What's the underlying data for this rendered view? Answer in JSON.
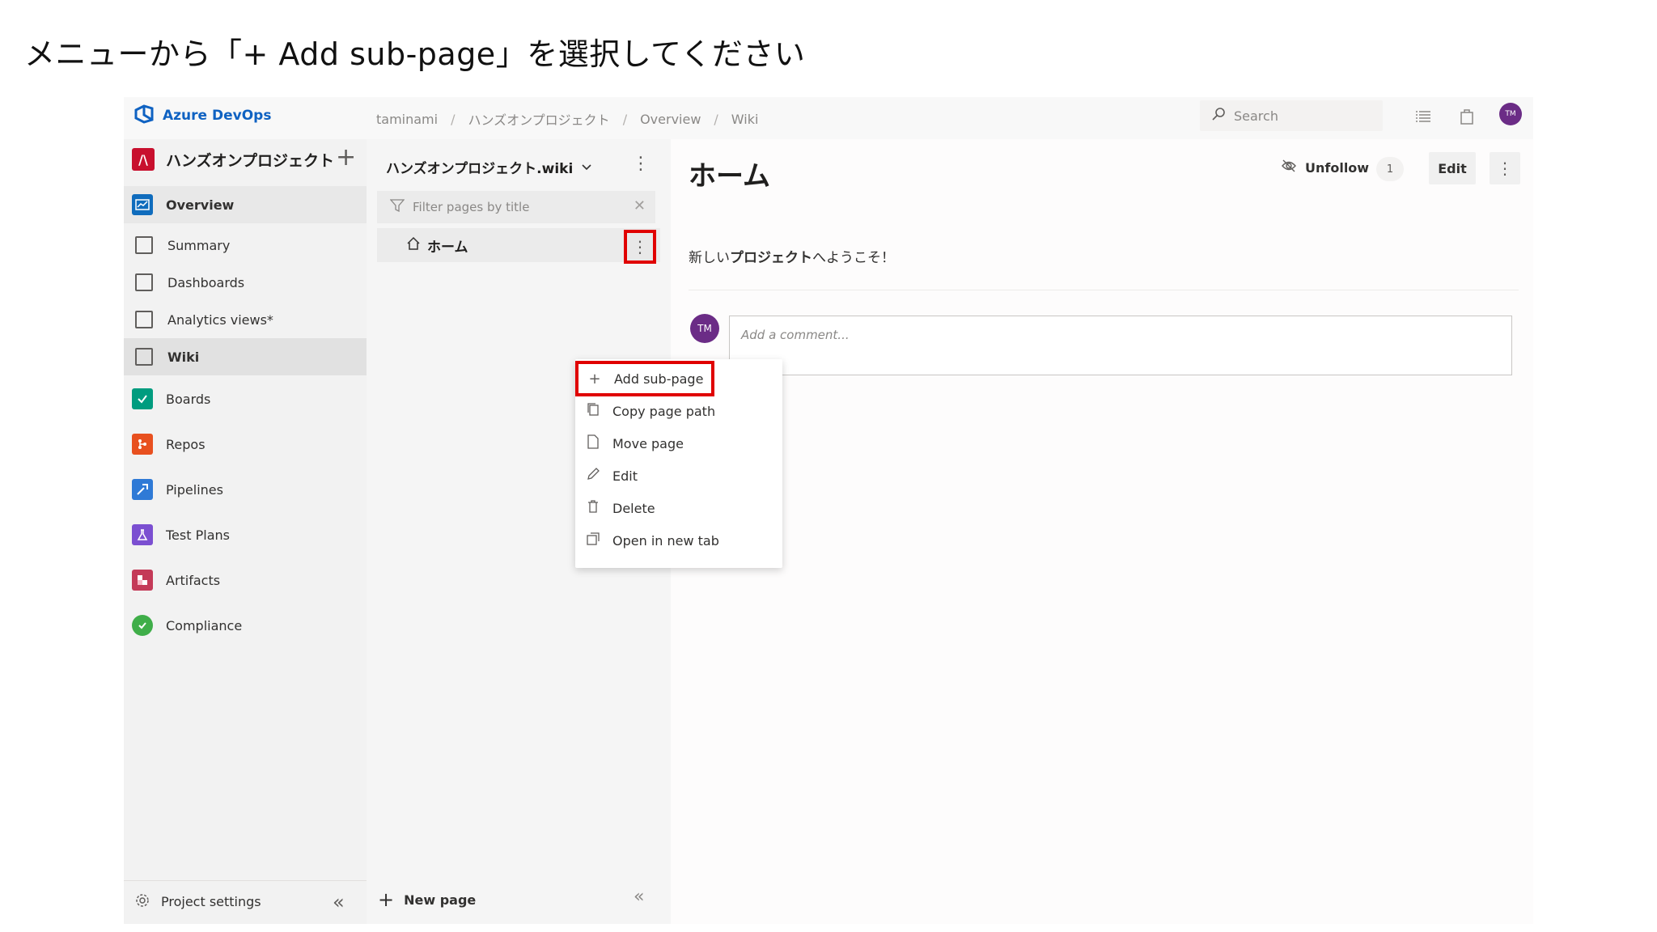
{
  "instruction": "メニューから「+ Add sub-page」を選択してください",
  "topbar": {
    "brand": "Azure DevOps",
    "breadcrumb": [
      "taminami",
      "ハンズオンプロジェクト",
      "Overview",
      "Wiki"
    ],
    "search_placeholder": "Search",
    "avatar_initials": "TM"
  },
  "project": {
    "badge": "/\\",
    "name": "ハンズオンプロジェクト"
  },
  "nav": {
    "items": [
      {
        "label": "Overview",
        "color": "#0f6cbd"
      },
      {
        "label": "Summary"
      },
      {
        "label": "Dashboards"
      },
      {
        "label": "Analytics views*"
      },
      {
        "label": "Wiki"
      },
      {
        "label": "Boards",
        "color": "#009c7f"
      },
      {
        "label": "Repos",
        "color": "#e8501f"
      },
      {
        "label": "Pipelines",
        "color": "#2f7ad6"
      },
      {
        "label": "Test Plans",
        "color": "#7b4fd1"
      },
      {
        "label": "Artifacts",
        "color": "#c43a58"
      },
      {
        "label": "Compliance",
        "color": "#3fae49"
      }
    ],
    "footer": "Project settings"
  },
  "wiki": {
    "title": "ハンズオンプロジェクト.wiki",
    "filter_placeholder": "Filter pages by title",
    "tree_root": "ホーム",
    "new_page": "New page"
  },
  "context_menu": {
    "items": [
      {
        "label": "Add sub-page",
        "icon": "plus-icon"
      },
      {
        "label": "Copy page path",
        "icon": "copy-icon"
      },
      {
        "label": "Move page",
        "icon": "page-icon"
      },
      {
        "label": "Edit",
        "icon": "pencil-icon"
      },
      {
        "label": "Delete",
        "icon": "trash-icon"
      },
      {
        "label": "Open in new tab",
        "icon": "new-tab-icon"
      }
    ]
  },
  "main": {
    "title": "ホーム",
    "unfollow_label": "Unfollow",
    "follow_count": "1",
    "edit_label": "Edit",
    "welcome_prefix": "新しい",
    "welcome_bold": "プロジェクト",
    "welcome_suffix": "へようこそ！",
    "comment_placeholder": "Add a comment...",
    "comment_avatar": "TM"
  },
  "colors": {
    "highlight": "#e00000",
    "brand": "#0f62c2",
    "avatar": "#6b2c86"
  }
}
